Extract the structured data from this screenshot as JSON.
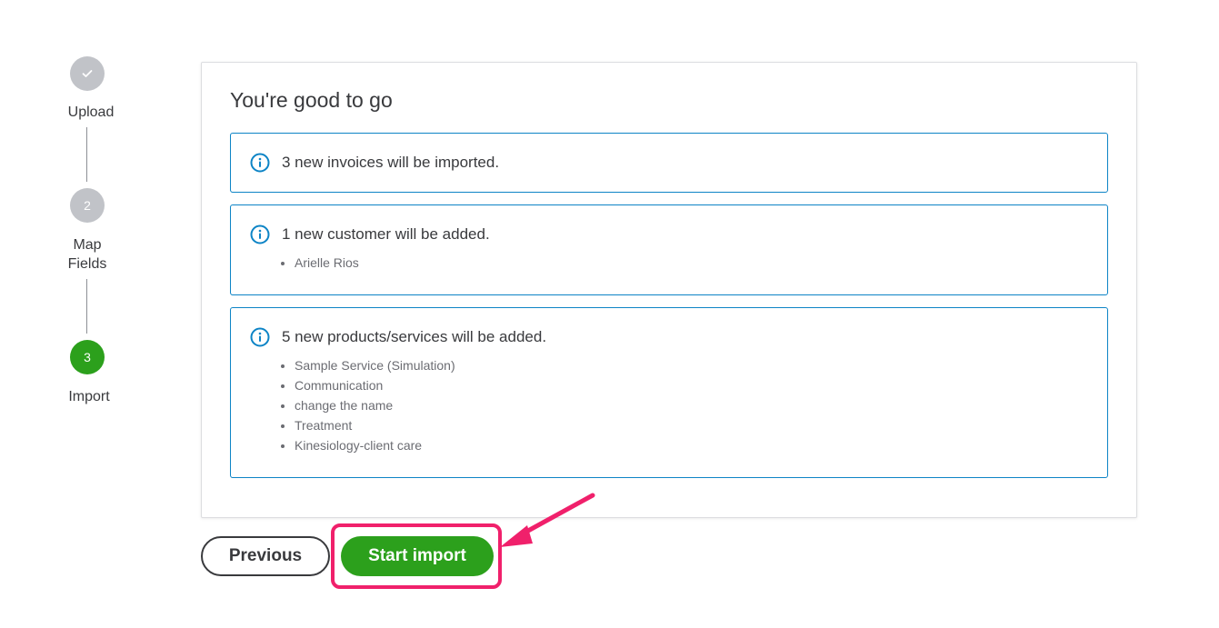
{
  "stepper": {
    "steps": [
      {
        "label": "Upload",
        "state": "done",
        "marker": "✓"
      },
      {
        "label": "Map\nFields",
        "state": "todo",
        "marker": "2"
      },
      {
        "label": "Import",
        "state": "active",
        "marker": "3"
      }
    ]
  },
  "card": {
    "title": "You're good to go",
    "invoices_text": "3 new invoices will be imported.",
    "customers_text": "1 new customer will be added.",
    "customers": [
      "Arielle Rios"
    ],
    "products_text": "5 new products/services will be added.",
    "products": [
      "Sample Service (Simulation)",
      "Communication",
      "change the name",
      "Treatment",
      "Kinesiology-client care"
    ]
  },
  "buttons": {
    "previous_label": "Previous",
    "start_import_label": "Start import"
  },
  "colors": {
    "accent_green": "#2ca01c",
    "info_blue": "#0d84c6",
    "annotation_pink": "#f0206b",
    "step_gray": "#c1c3c8"
  },
  "icons": {
    "info": "info-circle-icon",
    "done": "check-icon"
  }
}
